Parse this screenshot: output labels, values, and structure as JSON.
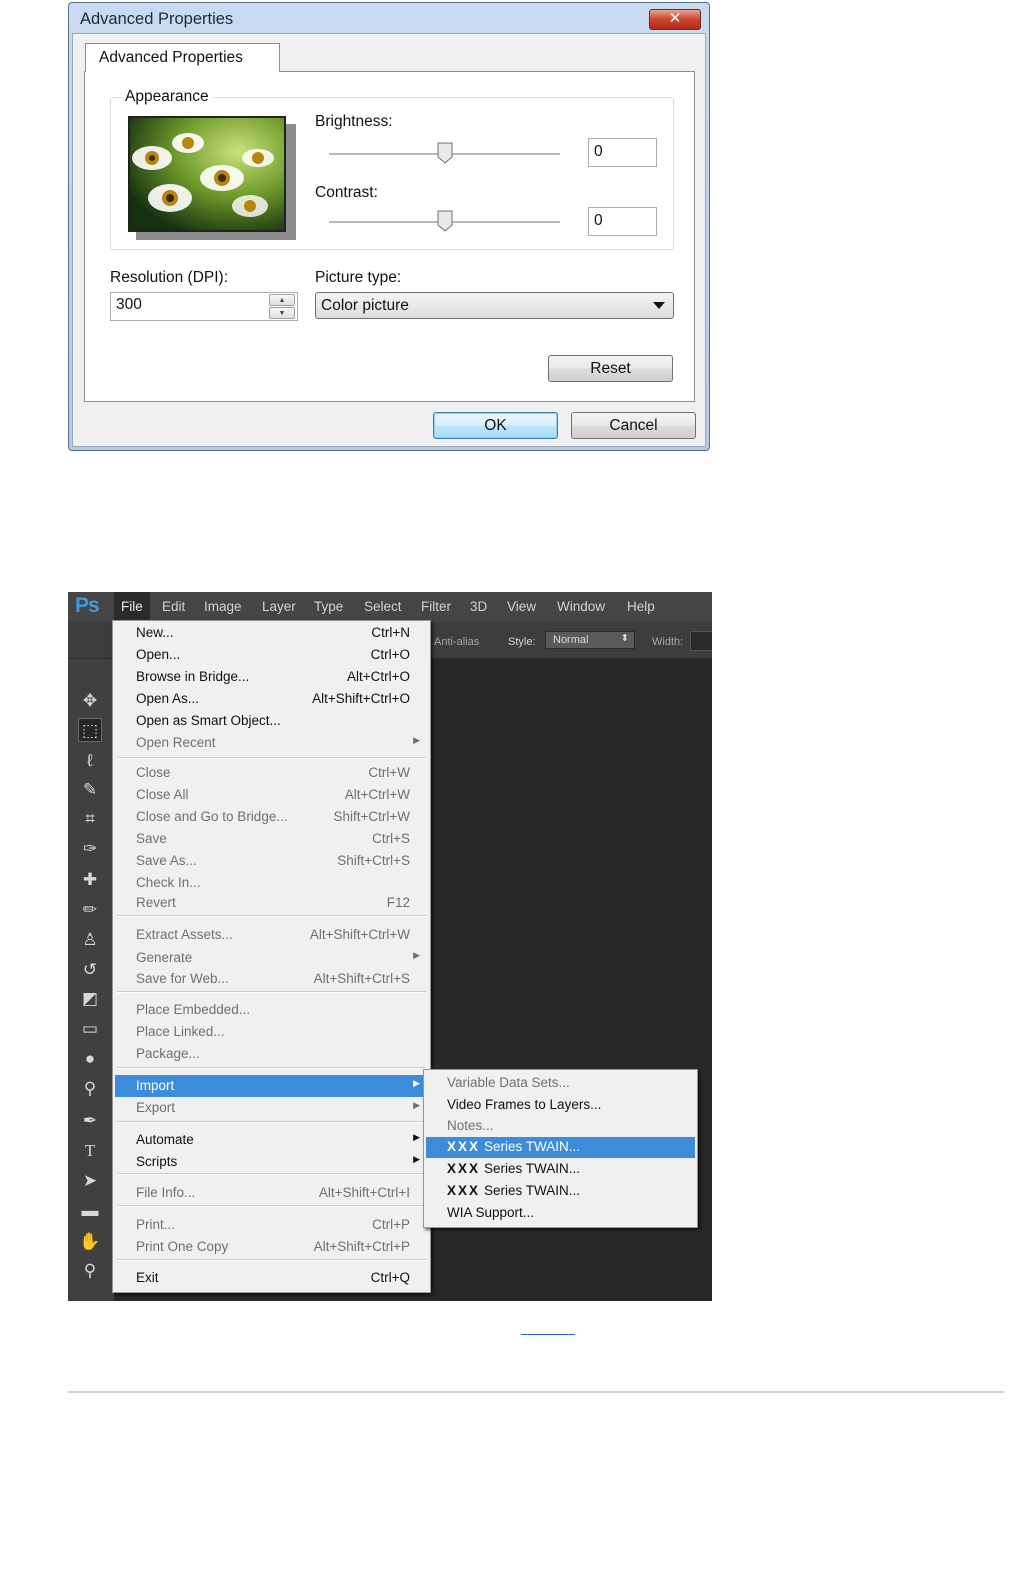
{
  "dialog": {
    "title": "Advanced Properties",
    "close_glyph": "✕",
    "tab_label": "Advanced Properties",
    "appearance_group": "Appearance",
    "brightness": {
      "label": "Brightness:",
      "value": "0",
      "level_fraction": 0.5
    },
    "contrast": {
      "label": "Contrast:",
      "value": "0",
      "level_fraction": 0.5
    },
    "resolution": {
      "label": "Resolution (DPI):",
      "value": "300"
    },
    "picture_type": {
      "label": "Picture type:",
      "value": "Color picture"
    },
    "buttons": {
      "reset": "Reset",
      "ok": "OK",
      "cancel": "Cancel"
    }
  },
  "photoshop": {
    "logo": "Ps",
    "menubar": [
      "File",
      "Edit",
      "Image",
      "Layer",
      "Type",
      "Select",
      "Filter",
      "3D",
      "View",
      "Window",
      "Help"
    ],
    "options_bar": {
      "antialias": "Anti-alias",
      "style_label": "Style:",
      "style_value": "Normal",
      "width_label": "Width:"
    },
    "file_menu": [
      {
        "label": "New...",
        "shortcut": "Ctrl+N",
        "enabled": true
      },
      {
        "label": "Open...",
        "shortcut": "Ctrl+O",
        "enabled": true
      },
      {
        "label": "Browse in Bridge...",
        "shortcut": "Alt+Ctrl+O",
        "enabled": true
      },
      {
        "label": "Open As...",
        "shortcut": "Alt+Shift+Ctrl+O",
        "enabled": true
      },
      {
        "label": "Open as Smart Object...",
        "shortcut": "",
        "enabled": true
      },
      {
        "label": "Open Recent",
        "shortcut": "",
        "enabled": false,
        "submenu": true
      },
      {
        "label": "Close",
        "shortcut": "Ctrl+W",
        "enabled": false
      },
      {
        "label": "Close All",
        "shortcut": "Alt+Ctrl+W",
        "enabled": false
      },
      {
        "label": "Close and Go to Bridge...",
        "shortcut": "Shift+Ctrl+W",
        "enabled": false
      },
      {
        "label": "Save",
        "shortcut": "Ctrl+S",
        "enabled": false
      },
      {
        "label": "Save As...",
        "shortcut": "Shift+Ctrl+S",
        "enabled": false
      },
      {
        "label": "Check In...",
        "shortcut": "",
        "enabled": false
      },
      {
        "label": "Revert",
        "shortcut": "F12",
        "enabled": false
      },
      {
        "label": "Extract Assets...",
        "shortcut": "Alt+Shift+Ctrl+W",
        "enabled": false
      },
      {
        "label": "Generate",
        "shortcut": "",
        "enabled": false,
        "submenu": true
      },
      {
        "label": "Save for Web...",
        "shortcut": "Alt+Shift+Ctrl+S",
        "enabled": false
      },
      {
        "label": "Place Embedded...",
        "shortcut": "",
        "enabled": false
      },
      {
        "label": "Place Linked...",
        "shortcut": "",
        "enabled": false
      },
      {
        "label": "Package...",
        "shortcut": "",
        "enabled": false
      },
      {
        "label": "Import",
        "shortcut": "",
        "enabled": true,
        "submenu": true,
        "highlighted": true
      },
      {
        "label": "Export",
        "shortcut": "",
        "enabled": false,
        "submenu": true
      },
      {
        "label": "Automate",
        "shortcut": "",
        "enabled": true,
        "submenu": true
      },
      {
        "label": "Scripts",
        "shortcut": "",
        "enabled": true,
        "submenu": true
      },
      {
        "label": "File Info...",
        "shortcut": "Alt+Shift+Ctrl+I",
        "enabled": false
      },
      {
        "label": "Print...",
        "shortcut": "Ctrl+P",
        "enabled": false
      },
      {
        "label": "Print One Copy",
        "shortcut": "Alt+Shift+Ctrl+P",
        "enabled": false
      },
      {
        "label": "Exit",
        "shortcut": "Ctrl+Q",
        "enabled": true
      }
    ],
    "import_submenu": [
      {
        "prefix": "",
        "label": "Variable Data Sets...",
        "enabled": false
      },
      {
        "prefix": "",
        "label": "Video Frames to Layers...",
        "enabled": true
      },
      {
        "prefix": "",
        "label": "Notes...",
        "enabled": false
      },
      {
        "prefix": "XXX",
        "label": "Series TWAIN...",
        "enabled": true,
        "highlighted": true
      },
      {
        "prefix": "XXX",
        "label": "Series TWAIN...",
        "enabled": true
      },
      {
        "prefix": "XXX",
        "label": "Series TWAIN...",
        "enabled": true
      },
      {
        "prefix": "",
        "label": "WIA Support...",
        "enabled": true
      }
    ],
    "tools": [
      "move-tool",
      "marquee-tool",
      "lasso-tool",
      "quick-selection-tool",
      "crop-tool",
      "eyedropper-tool",
      "healing-brush-tool",
      "brush-tool",
      "clone-stamp-tool",
      "history-brush-tool",
      "eraser-tool",
      "gradient-tool",
      "blur-tool",
      "dodge-tool",
      "pen-tool",
      "type-tool",
      "path-selection-tool",
      "rectangle-tool",
      "hand-tool",
      "zoom-tool"
    ]
  },
  "colors": {
    "accent": "#3c8cd9",
    "ps_dark": "#282828"
  }
}
